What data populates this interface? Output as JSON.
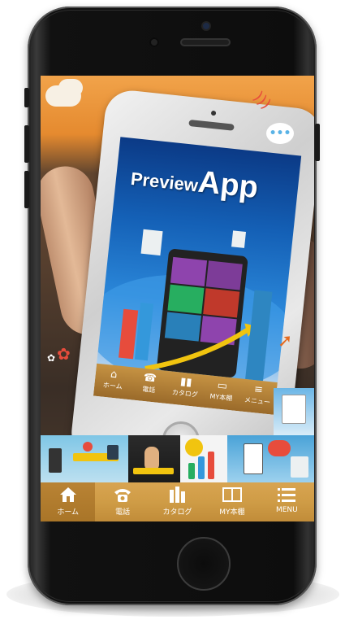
{
  "app": {
    "title_part1": "Preview",
    "title_part2": "App"
  },
  "inner_nav": [
    {
      "label": "ホーム",
      "icon": "home-icon"
    },
    {
      "label": "電話",
      "icon": "phone-icon"
    },
    {
      "label": "カタログ",
      "icon": "catalog-icon"
    },
    {
      "label": "MY本棚",
      "icon": "book-icon"
    },
    {
      "label": "メニュー",
      "icon": "menu-icon"
    }
  ],
  "nav": [
    {
      "label": "ホーム",
      "icon": "home-icon"
    },
    {
      "label": "電話",
      "icon": "phone-icon"
    },
    {
      "label": "カタログ",
      "icon": "catalog-icon"
    },
    {
      "label": "MY本棚",
      "icon": "book-icon"
    },
    {
      "label": "MENU",
      "icon": "menu-icon"
    }
  ],
  "colors": {
    "nav_bar": "#d8a451",
    "accent_orange": "#e58a2f",
    "inner_screen_blue": "#1460b6"
  },
  "chat_bubble": "•••"
}
